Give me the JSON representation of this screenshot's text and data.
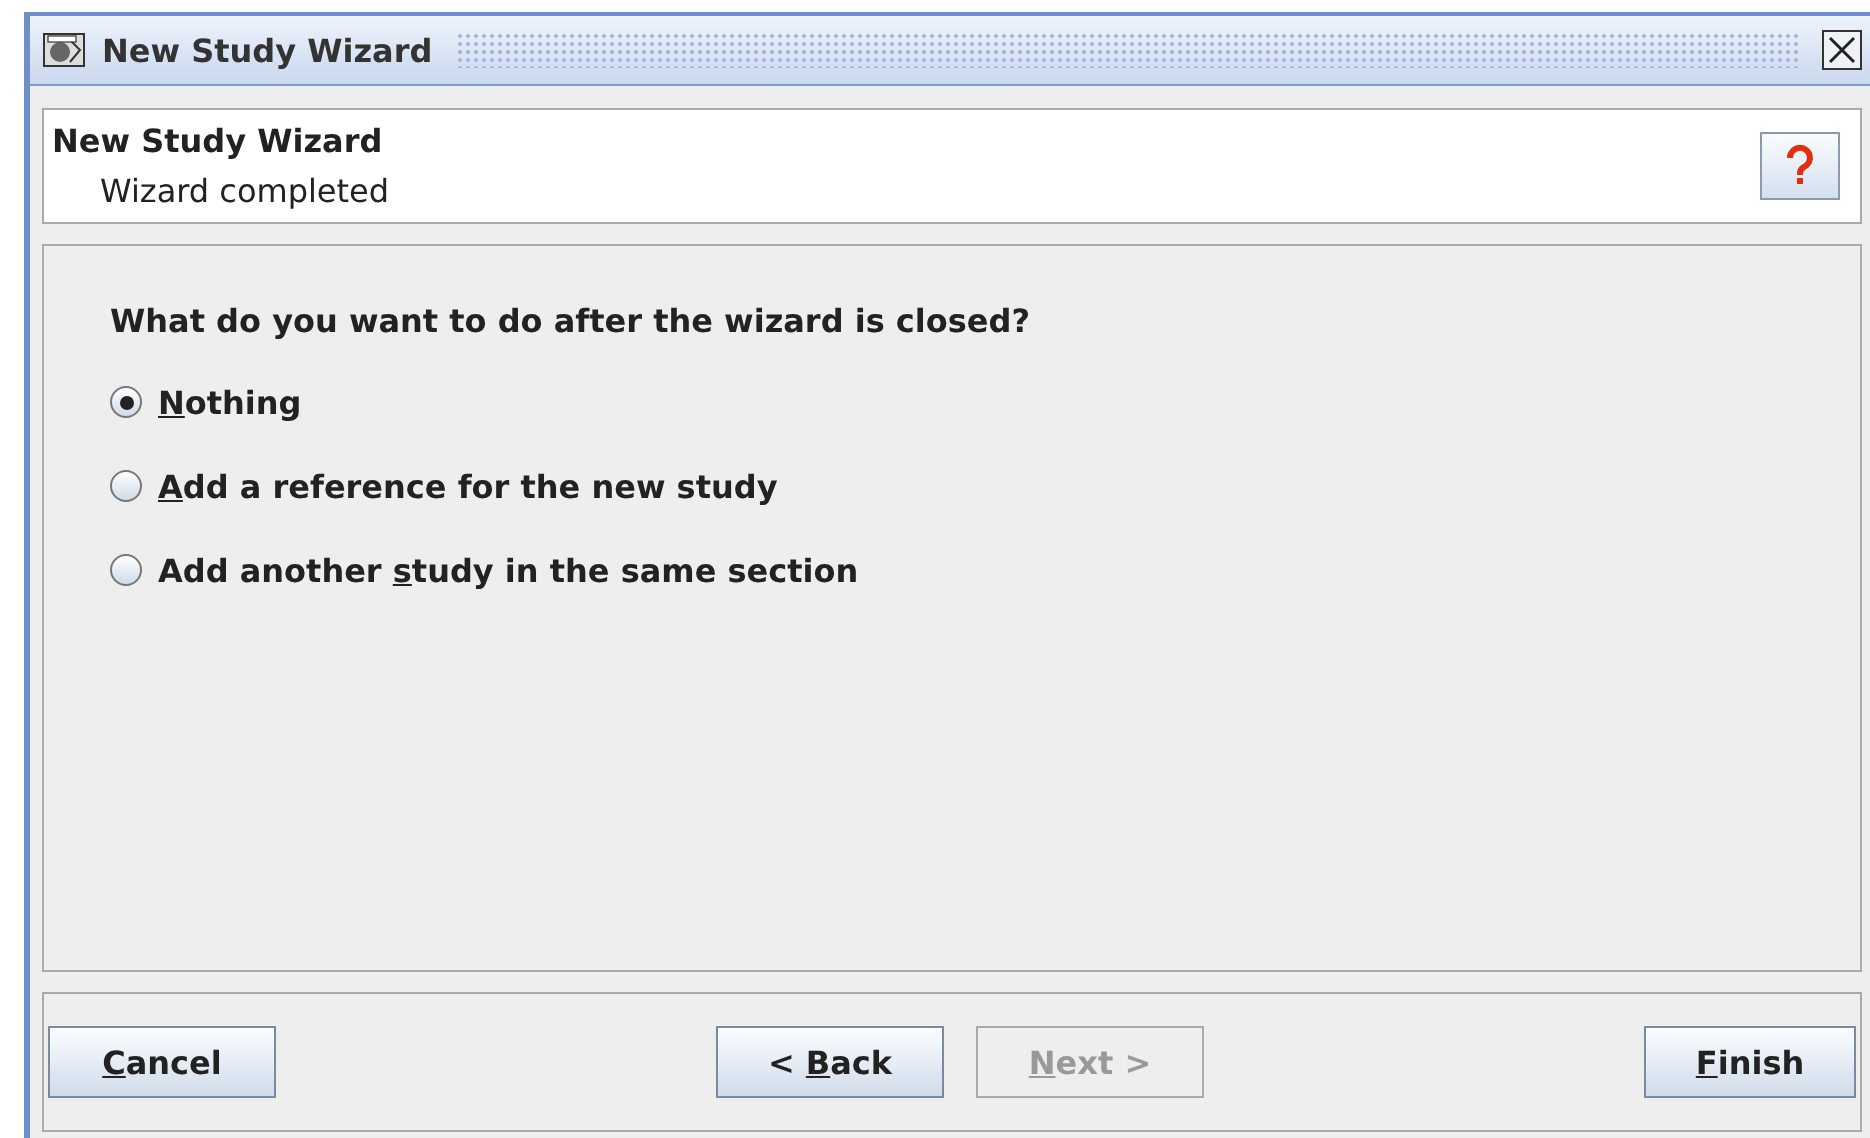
{
  "window": {
    "title": "New Study Wizard"
  },
  "header": {
    "title": "New Study Wizard",
    "subtitle": "Wizard completed"
  },
  "question": "What do you want to do after the wizard is closed?",
  "options": [
    {
      "key": "N",
      "after": "othing",
      "selected": true
    },
    {
      "key": "A",
      "after": "dd a reference for the new study",
      "selected": false
    },
    {
      "before": "Add another ",
      "key": "s",
      "after": "tudy in the same section",
      "selected": false
    }
  ],
  "buttons": [
    {
      "key": "C",
      "after": "ancel",
      "disabled": false,
      "kind": "left"
    },
    {
      "before": "< ",
      "key": "B",
      "after": "ack",
      "disabled": false,
      "kind": "center"
    },
    {
      "key": "N",
      "after": "ext >",
      "disabled": true,
      "kind": "center"
    },
    {
      "key": "F",
      "after": "inish",
      "disabled": false,
      "kind": "right"
    }
  ]
}
